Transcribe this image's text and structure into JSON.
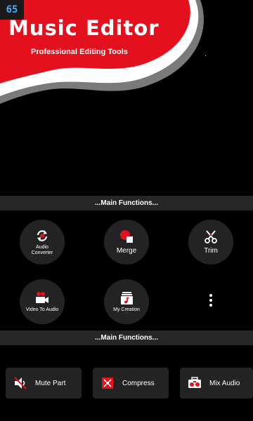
{
  "status": {
    "badge": "65"
  },
  "header": {
    "title": "Music Editor",
    "subtitle": "Professional Editing Tools"
  },
  "sections": {
    "main_functions_1": "...Main Functions...",
    "main_functions_2": "...Main Functions..."
  },
  "functions": {
    "audio_converter": {
      "label": "Audio Converter",
      "icon": "refresh-cycle-icon"
    },
    "merge": {
      "label": "Merge",
      "icon": "merge-icon"
    },
    "trim": {
      "label": "Trim",
      "icon": "scissors-icon"
    },
    "video_to_audio": {
      "label": "Video To Audio",
      "icon": "video-camera-icon"
    },
    "my_creation": {
      "label": "My Creation",
      "icon": "music-folder-icon"
    },
    "more": {
      "icon": "more-vertical-icon"
    }
  },
  "tools": {
    "mute_part": {
      "label": "Mute Part",
      "icon": "speaker-mute-icon"
    },
    "compress": {
      "label": "Compress",
      "icon": "compress-icon"
    },
    "mix_audio": {
      "label": "Mix Audio",
      "icon": "boombox-icon"
    }
  },
  "colors": {
    "brand_red": "#e3101d",
    "background": "#000000",
    "surface": "#232323",
    "section_bar": "#262626"
  }
}
